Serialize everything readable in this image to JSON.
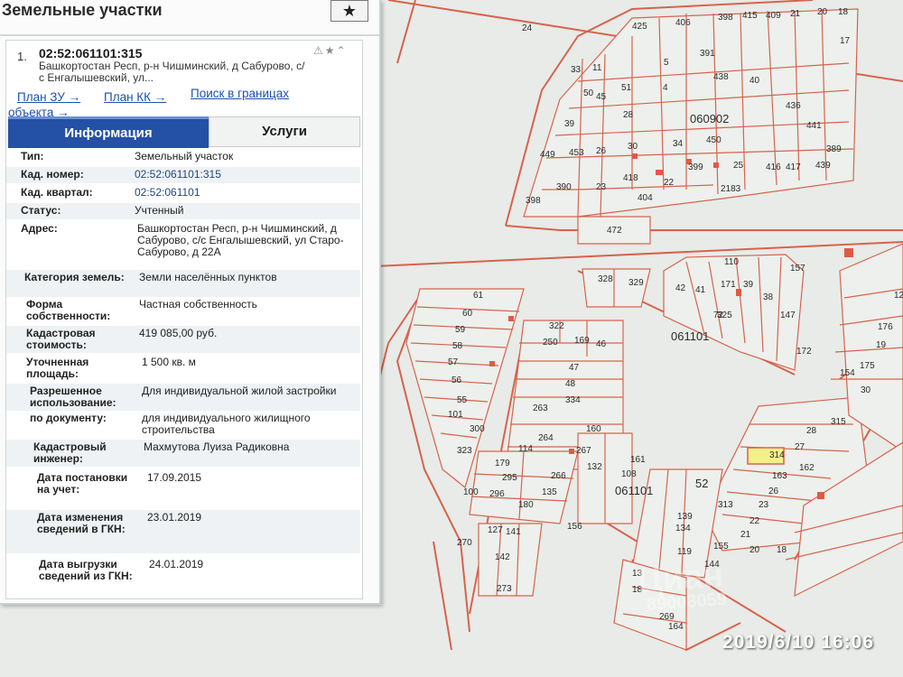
{
  "panel": {
    "title": "Земельные участки",
    "tools_icon": "★",
    "result": {
      "index": "1.",
      "cad_number": "02:52:061101:315",
      "address_short": "Башкортостан Респ, р-н Чишминский, д Сабурово, с/с Енгалышевский, ул...",
      "icons": "⚠★⌃"
    },
    "links": {
      "plan_zu": "План ЗУ →",
      "plan_kk": "План КК →",
      "search_a": "Поиск в границах",
      "search_b": "объекта →"
    },
    "tabs": {
      "info": "Информация",
      "services": "Услуги"
    },
    "attributes": [
      {
        "key": "Тип:",
        "value": "Земельный участок"
      },
      {
        "key": "Кад. номер:",
        "value": "02:52:061101:315"
      },
      {
        "key": "Кад. квартал:",
        "value": "02:52:061101"
      },
      {
        "key": "Статус:",
        "value": "Учтенный"
      },
      {
        "key": "Адрес:",
        "value": "Башкортостан Респ, р-н Чишминский, д Сабурово, с/с Енгалышевский, ул Старо-Сабурово, д 22А"
      },
      {
        "key": "Категория земель:",
        "value": "Земли населённых пунктов"
      },
      {
        "key": "Форма собственности:",
        "value": "Частная собственность"
      },
      {
        "key": "Кадастровая стоимость:",
        "value": "419 085,00 руб."
      },
      {
        "key": "Уточненная площадь:",
        "value": "1 500 кв. м"
      },
      {
        "key": "Разрешенное использование:",
        "value": "Для индивидуальной жилой застройки"
      },
      {
        "key": "по документу:",
        "value": "для индивидуального жилищного строительства"
      },
      {
        "key": "Кадастровый инженер:",
        "value": "Махмутова Луиза Радиковна"
      },
      {
        "key": "Дата постановки на учет:",
        "value": "17.09.2015"
      },
      {
        "key": "Дата изменения сведений в ГКН:",
        "value": "23.01.2019"
      },
      {
        "key": "Дата выгрузки сведений из ГКН:",
        "value": "24.01.2019"
      }
    ]
  },
  "map": {
    "labels": [
      "24",
      "406",
      "398",
      "415",
      "409",
      "21",
      "20",
      "18",
      "17",
      "425",
      "391",
      "11",
      "51",
      "4",
      "50",
      "5",
      "438",
      "40",
      "436",
      "441",
      "28",
      "39",
      "45",
      "33",
      "060902",
      "449",
      "453",
      "26",
      "30",
      "34",
      "450",
      "416",
      "417",
      "439",
      "390",
      "398",
      "23",
      "418",
      "22",
      "399",
      "25",
      "2183",
      "389",
      "404",
      "472",
      "328",
      "329",
      "110",
      "157",
      "42",
      "41",
      "72",
      "171",
      "39",
      "38",
      "61",
      "60",
      "59",
      "58",
      "57",
      "56",
      "55",
      "101",
      "300",
      "323",
      "322",
      "250",
      "169",
      "46",
      "47",
      "48",
      "334",
      "263",
      "264",
      "267",
      "114",
      "179",
      "295",
      "296",
      "180",
      "135",
      "266",
      "132",
      "160",
      "161",
      "108",
      "061101",
      "061101",
      "156",
      "147",
      "172",
      "325",
      "52",
      "313",
      "27",
      "28",
      "315",
      "314",
      "162",
      "163",
      "26",
      "23",
      "22",
      "21",
      "20",
      "18",
      "19",
      "176",
      "175",
      "30",
      "154",
      "155",
      "144",
      "139",
      "134",
      "119",
      "100",
      "270",
      "127",
      "141",
      "142",
      "273",
      "269",
      "164",
      "13",
      "18",
      "12",
      "10",
      "153"
    ],
    "quarter_labels": [
      "060902",
      "061101",
      "061101",
      "52"
    ]
  },
  "watermark": {
    "brand": "Циан",
    "phone": "89008059",
    "timestamp": "2019/6/10  16:06"
  },
  "colors": {
    "parcel": "#d6634e",
    "selected": "#f3f08a",
    "tab_active": "#2450a5",
    "link": "#1f4fb0"
  }
}
